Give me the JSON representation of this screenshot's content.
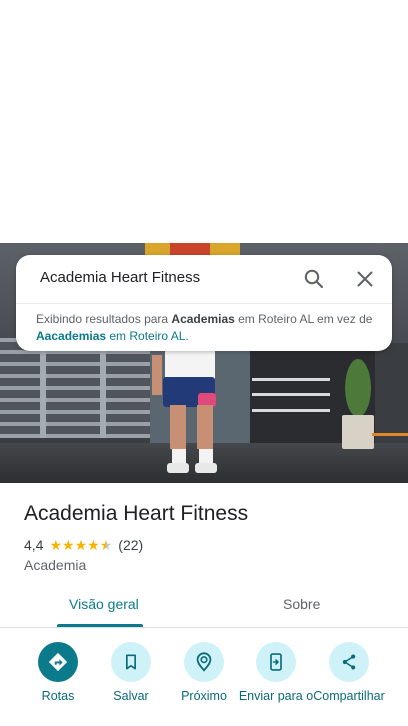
{
  "search": {
    "query": "Academia Heart Fitness",
    "note_prefix": "Exibindo resultados para ",
    "note_term": "Academias",
    "note_mid": " em Roteiro AL em vez de ",
    "note_orig_term": "Aacademias",
    "note_orig_suffix": " em Roteiro AL",
    "note_end": "."
  },
  "place": {
    "title": "Academia Heart Fitness",
    "rating": "4,4",
    "stars": 4.4,
    "reviews": "(22)",
    "category": "Academia"
  },
  "tabs": [
    {
      "label": "Visão geral",
      "active": true
    },
    {
      "label": "Sobre",
      "active": false
    }
  ],
  "actions": [
    {
      "label": "Rotas",
      "icon": "directions-icon"
    },
    {
      "label": "Salvar",
      "icon": "bookmark-icon"
    },
    {
      "label": "Próximo",
      "icon": "nearby-icon"
    },
    {
      "label": "Enviar para o",
      "icon": "send-to-phone-icon"
    },
    {
      "label": "Compartilhar",
      "icon": "share-icon"
    }
  ],
  "colors": {
    "accent": "#0b7a8a",
    "button_bg": "#cff2f8",
    "star": "#f4b400"
  }
}
